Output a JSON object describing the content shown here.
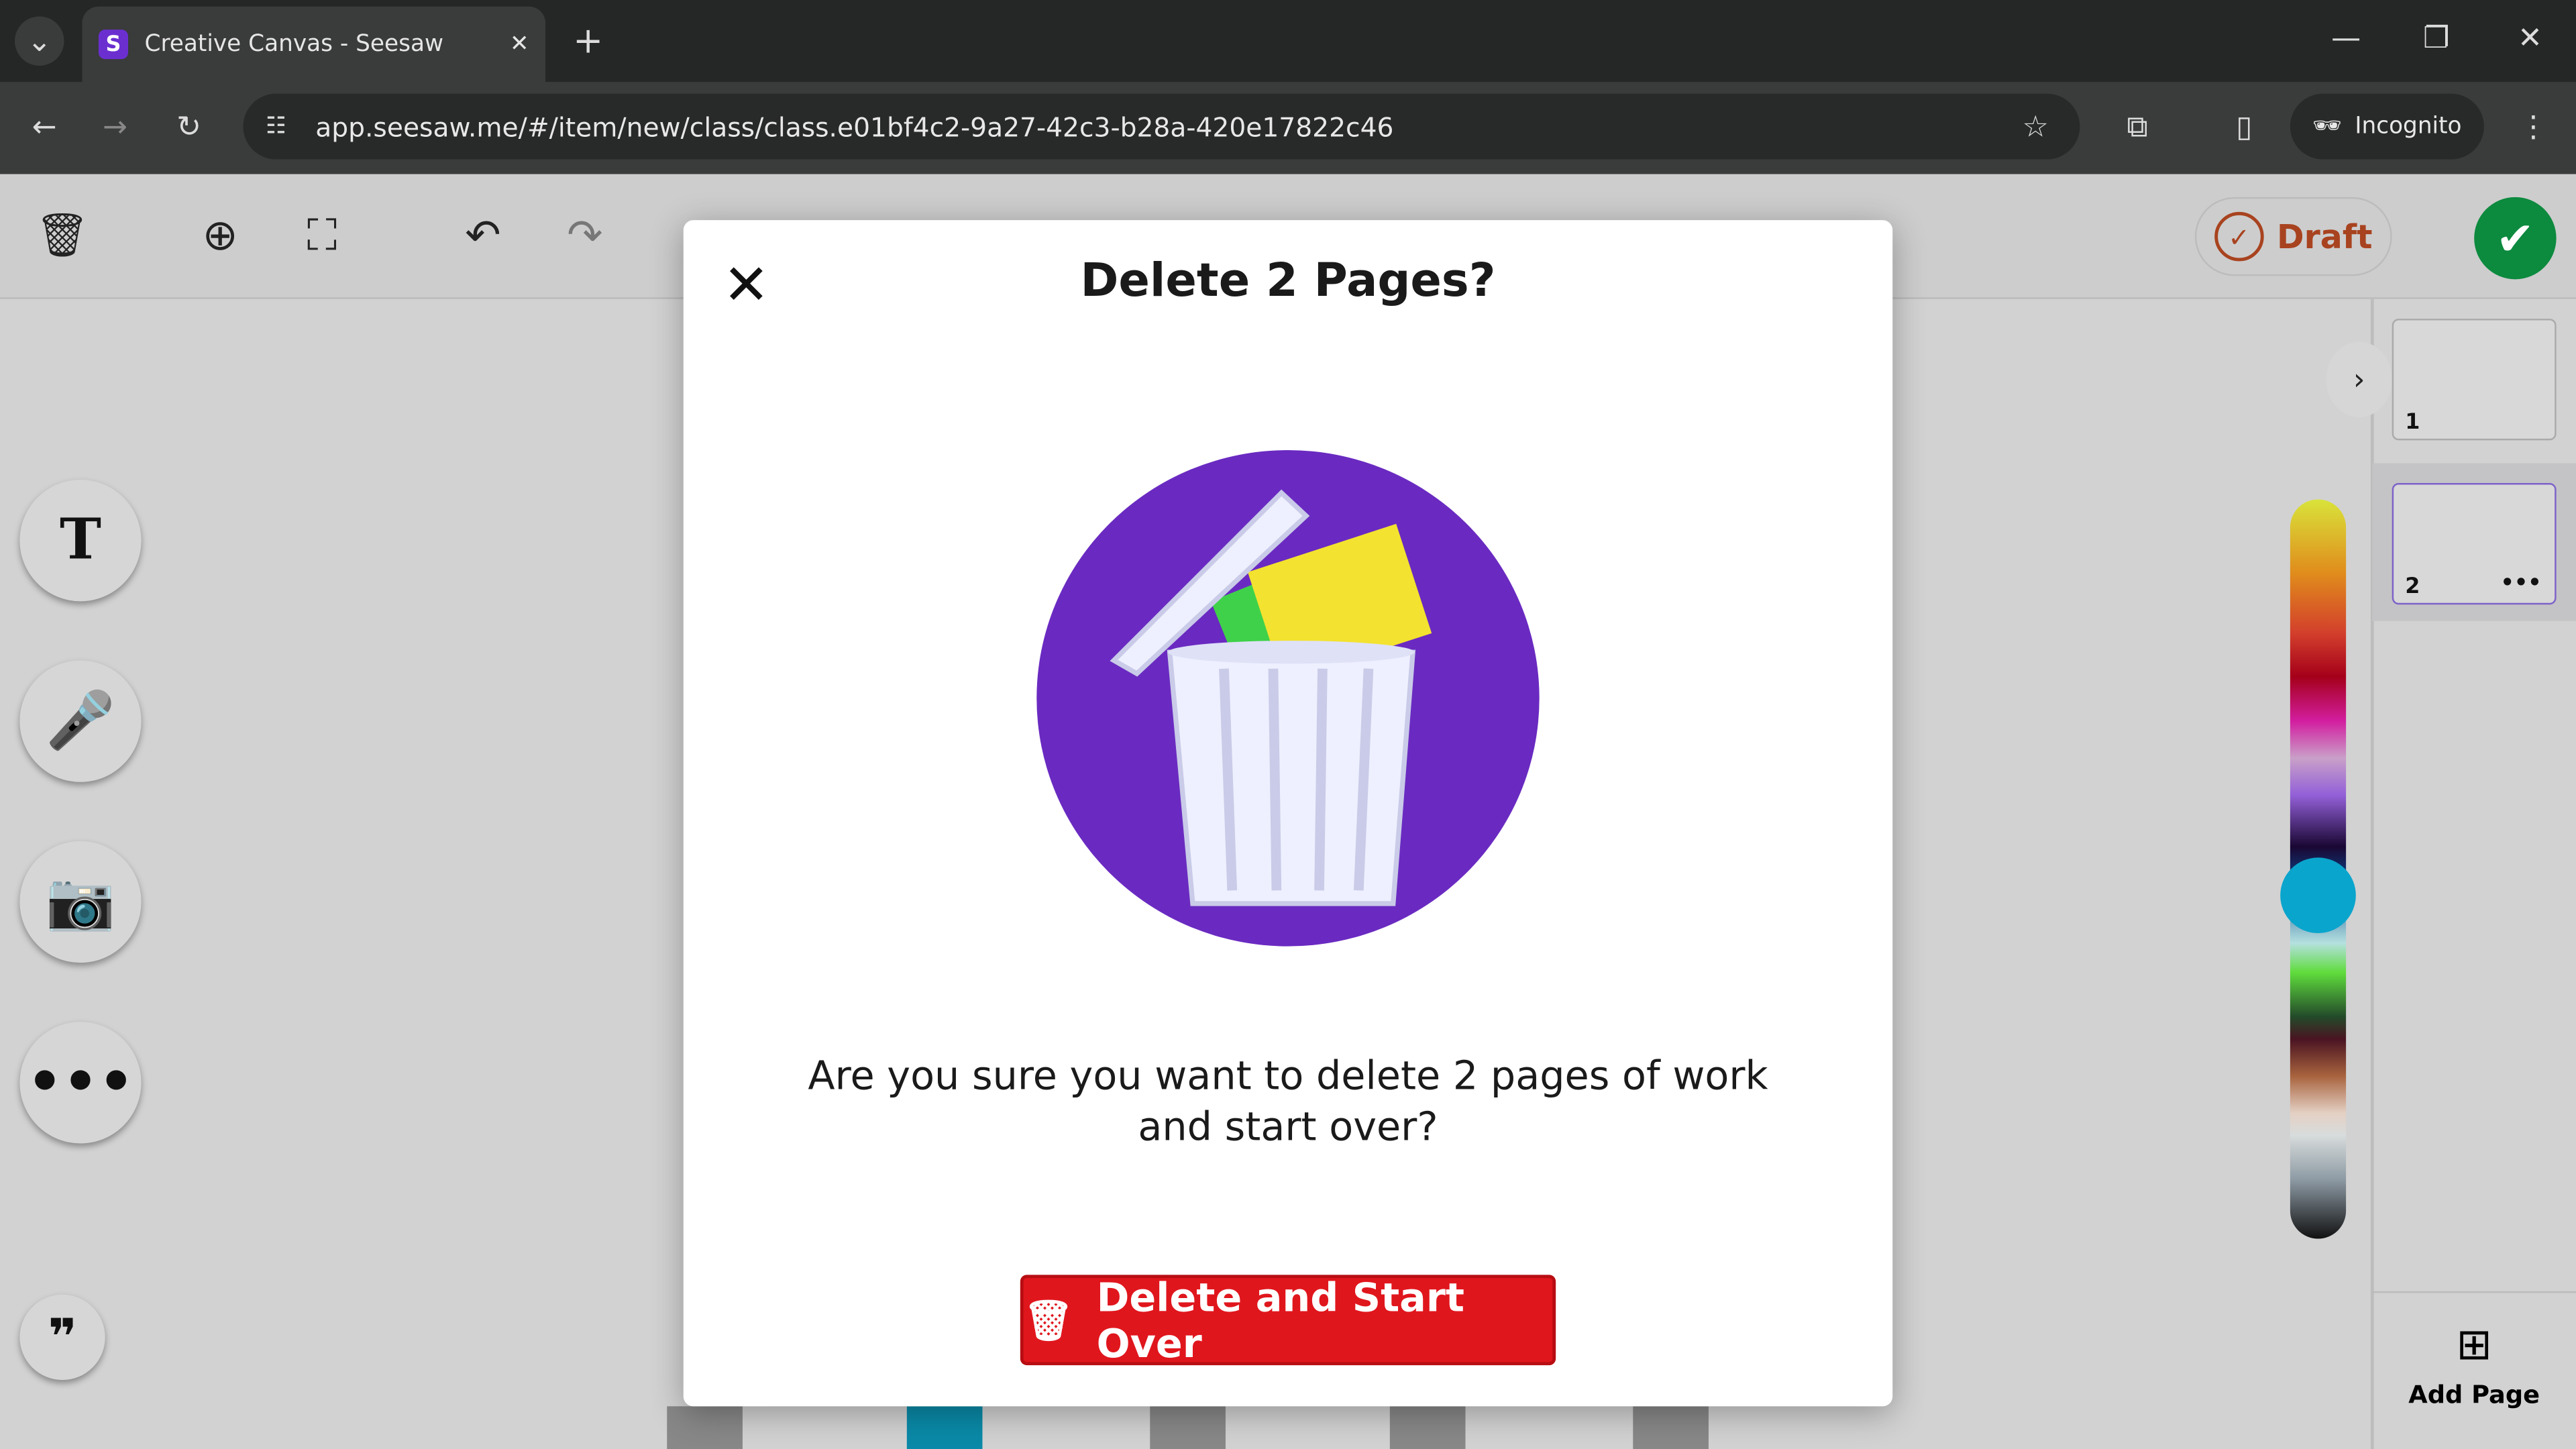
{
  "browser": {
    "tab_title": "Creative Canvas - Seesaw",
    "favicon": "S",
    "url": "app.seesaw.me/#/item/new/class/class.e01bf4c2-9a27-42c3-b28a-420e17822c46",
    "profile": "Incognito"
  },
  "toolbar": {
    "draft_label": "Draft",
    "accent_done": "#0c8a3e",
    "draft_color": "#a8431f"
  },
  "pages": [
    {
      "number": "1"
    },
    {
      "number": "2",
      "menu": "•••"
    }
  ],
  "add_page_label": "Add Page",
  "palette": {
    "selected_color": "#0aa5cc"
  },
  "dialog": {
    "title": "Delete 2 Pages?",
    "message": "Are you sure you want to delete 2 pages of work and start over?",
    "confirm_label": "Delete and Start Over",
    "confirm_color": "#e0161d"
  }
}
